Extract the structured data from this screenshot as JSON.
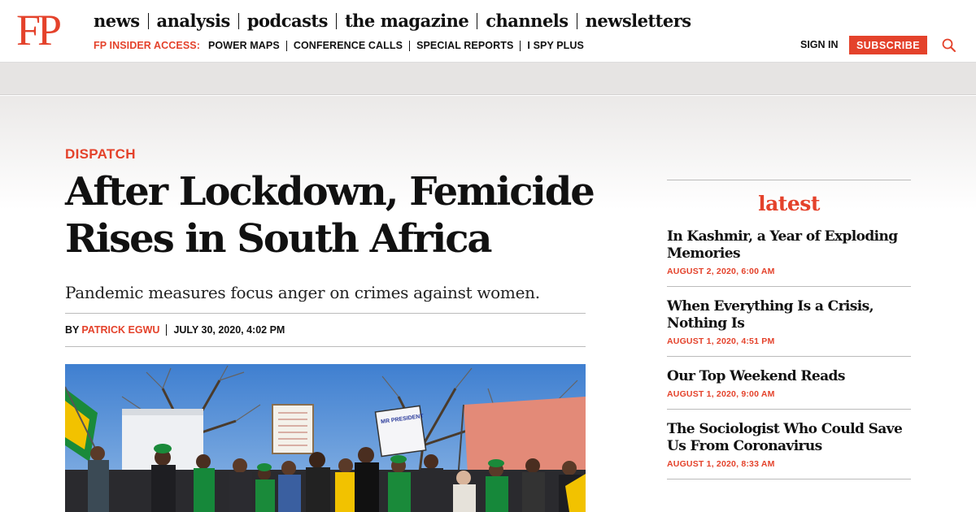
{
  "header": {
    "logo": "FP",
    "nav": [
      "news",
      "analysis",
      "podcasts",
      "the magazine",
      "channels",
      "newsletters"
    ],
    "insider_label": "FP INSIDER ACCESS:",
    "insider_links": [
      "POWER MAPS",
      "CONFERENCE CALLS",
      "SPECIAL REPORTS",
      "I SPY PLUS"
    ],
    "signin": "SIGN IN",
    "subscribe": "SUBSCRIBE",
    "search_icon": "search-icon"
  },
  "article": {
    "kicker": "DISPATCH",
    "headline": "After Lockdown, Femicide Rises in South Africa",
    "dek": "Pandemic measures focus anger on crimes against women.",
    "by": "BY",
    "author": "PATRICK EGWU",
    "date": "JULY 30, 2020, 4:02 PM",
    "hero_signs": [
      "MR PRESIDENT"
    ]
  },
  "latest": {
    "title": "latest",
    "items": [
      {
        "title": "In Kashmir, a Year of Exploding Memories",
        "date": "AUGUST 2, 2020, 6:00 AM"
      },
      {
        "title": "When Everything Is a Crisis, Nothing Is",
        "date": "AUGUST 1, 2020, 4:51 PM"
      },
      {
        "title": "Our Top Weekend Reads",
        "date": "AUGUST 1, 2020, 9:00 AM"
      },
      {
        "title": "The Sociologist Who Could Save Us From Coronavirus",
        "date": "AUGUST 1, 2020, 8:33 AM"
      }
    ]
  },
  "colors": {
    "brand_red": "#e4422b",
    "text": "#111111",
    "band_gray": "#e6e4e3"
  }
}
